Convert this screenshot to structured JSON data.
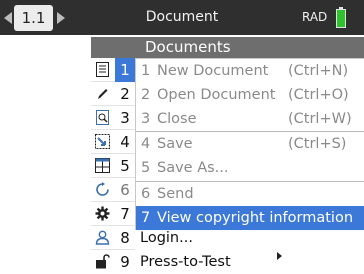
{
  "topbar": {
    "tab_label": "1.1",
    "title": "Document",
    "mode": "RAD",
    "colors": {
      "bar": "#2f2f2f",
      "battery": "#2ec22e"
    }
  },
  "menu": {
    "header": "Documents",
    "categories": [
      {
        "num": "1",
        "icon": "new-document-icon"
      },
      {
        "num": "2",
        "icon": "pencil-icon"
      },
      {
        "num": "3",
        "icon": "zoom-page-icon"
      },
      {
        "num": "4",
        "icon": "save-icon"
      },
      {
        "num": "5",
        "icon": "layout-icon"
      },
      {
        "num": "6",
        "icon": "send-icon"
      },
      {
        "num": "7",
        "icon": "gear-icon"
      },
      {
        "num": "8",
        "icon": "user-icon"
      },
      {
        "num": "9",
        "icon": "lock-icon"
      }
    ],
    "items": [
      {
        "num": "1",
        "label": "New Document",
        "shortcut": "(Ctrl+N)"
      },
      {
        "num": "2",
        "label": "Open Document",
        "shortcut": "(Ctrl+O)"
      },
      {
        "num": "3",
        "label": "Close",
        "shortcut": "(Ctrl+W)"
      },
      {
        "num": "4",
        "label": "Save",
        "shortcut": "(Ctrl+S)"
      },
      {
        "num": "5",
        "label": "Save As...",
        "shortcut": ""
      },
      {
        "num": "6",
        "label": "Send",
        "shortcut": ""
      },
      {
        "num": "7",
        "label": "View copyright information",
        "shortcut": ""
      }
    ],
    "lower_items": [
      {
        "label": "Login..."
      },
      {
        "label": "Press-to-Test"
      }
    ],
    "highlight_color": "#3c78d8"
  }
}
